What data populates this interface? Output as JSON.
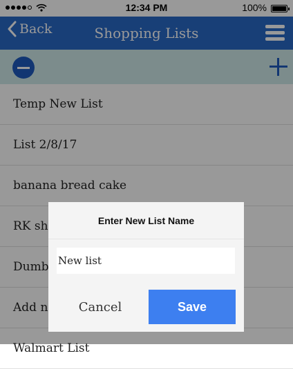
{
  "status_bar": {
    "time": "12:34 PM",
    "battery": "100%",
    "signal_bars_filled": 4,
    "signal_bars_total": 5
  },
  "nav": {
    "back_label": "Back",
    "title": "Shopping Lists",
    "color": "#2969c7"
  },
  "toolbar": {
    "color": "#cfeaea",
    "accent": "#1e5bbf"
  },
  "lists": [
    "Temp New List",
    "List 2/8/17",
    "banana bread cake",
    "RK shop",
    "Dumbo",
    "Add new",
    "Walmart List"
  ],
  "dialog": {
    "title": "Enter New List Name",
    "input_value": "New list",
    "cancel_label": "Cancel",
    "save_label": "Save",
    "save_color": "#3d7ff0"
  }
}
